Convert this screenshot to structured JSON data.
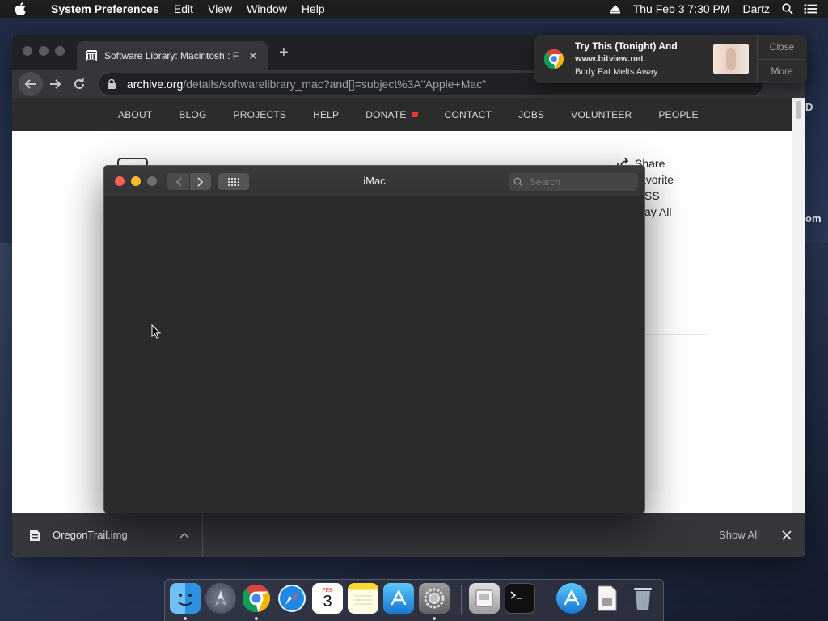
{
  "menubar": {
    "app_name": "System Preferences",
    "items": [
      "Edit",
      "View",
      "Window",
      "Help"
    ],
    "clock": "Thu Feb 3  7:30 PM",
    "user": "Dartz"
  },
  "browser": {
    "tab_title": "Software Library: Macintosh : F",
    "url_host": "archive.org",
    "url_path": "/details/softwarelibrary_mac?and[]=subject%3A\"Apple+Mac\"",
    "nav": [
      "ABOUT",
      "BLOG",
      "PROJECTS",
      "HELP",
      "DONATE",
      "CONTACT",
      "JOBS",
      "VOLUNTEER",
      "PEOPLE"
    ],
    "side_links": [
      "Share",
      "avorite",
      "SS",
      "ay All"
    ],
    "download": {
      "filename": "OregonTrail.img",
      "show_all": "Show All"
    },
    "edge_letters": [
      "D",
      "om"
    ]
  },
  "finder": {
    "title": "iMac",
    "search_placeholder": "Search"
  },
  "notification": {
    "headline": "Try This (Tonight) And",
    "site": "www.bitview.net",
    "body": "Body Fat Melts Away",
    "close_label": "Close",
    "more_label": "More"
  },
  "dock": {
    "calendar_month": "FEB",
    "calendar_day": "3"
  },
  "colors": {
    "red_light": "#fe5f57",
    "yellow_light": "#febc2e",
    "gray_light": "#6e6e6e",
    "donate_heart": "#e53935"
  }
}
